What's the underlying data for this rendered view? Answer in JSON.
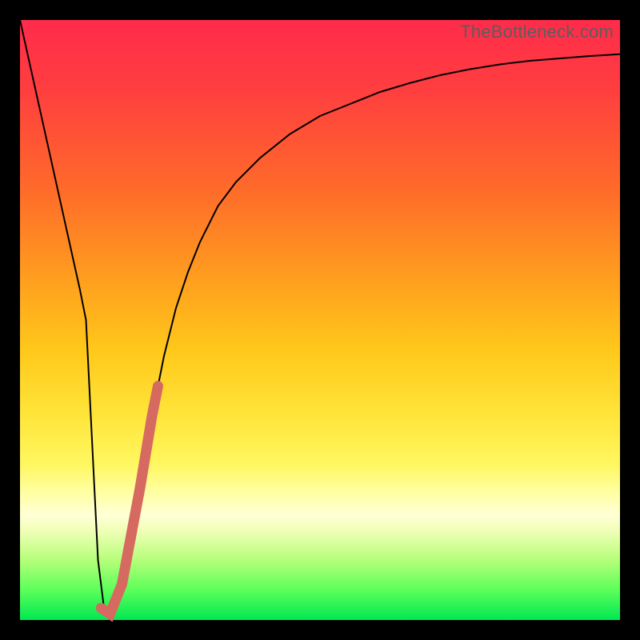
{
  "watermark": "TheBottleneck.com",
  "chart_data": {
    "type": "line",
    "title": "",
    "xlabel": "",
    "ylabel": "",
    "xlim": [
      0,
      100
    ],
    "ylim": [
      0,
      100
    ],
    "grid": false,
    "legend": false,
    "gradient_background_top_to_bottom": [
      "#ff2b4a",
      "#ffe53a",
      "#00e853"
    ],
    "series": [
      {
        "name": "curve",
        "stroke": "#000000",
        "stroke_width": 2,
        "x": [
          0,
          2,
          4,
          6,
          8,
          10,
          11,
          12,
          13,
          14,
          15,
          16,
          18,
          20,
          22,
          24,
          26,
          28,
          30,
          33,
          36,
          40,
          45,
          50,
          55,
          60,
          65,
          70,
          75,
          80,
          85,
          90,
          95,
          100
        ],
        "values": [
          100,
          91,
          82,
          73,
          64,
          55,
          50,
          30,
          10,
          2,
          0,
          2,
          10,
          22,
          34,
          44,
          52,
          58,
          63,
          69,
          73,
          77,
          81,
          84,
          86,
          88,
          89.5,
          90.8,
          91.8,
          92.6,
          93.2,
          93.6,
          94.0,
          94.3
        ]
      },
      {
        "name": "highlight-segment",
        "stroke": "#d66a60",
        "stroke_width": 13,
        "linecap": "round",
        "x": [
          13.5,
          15.0,
          17.0,
          18.5,
          20.0,
          21.0,
          22.0,
          23.0
        ],
        "values": [
          2.0,
          1.0,
          6.0,
          14.0,
          22.0,
          28.0,
          34.0,
          39.0
        ]
      }
    ]
  }
}
